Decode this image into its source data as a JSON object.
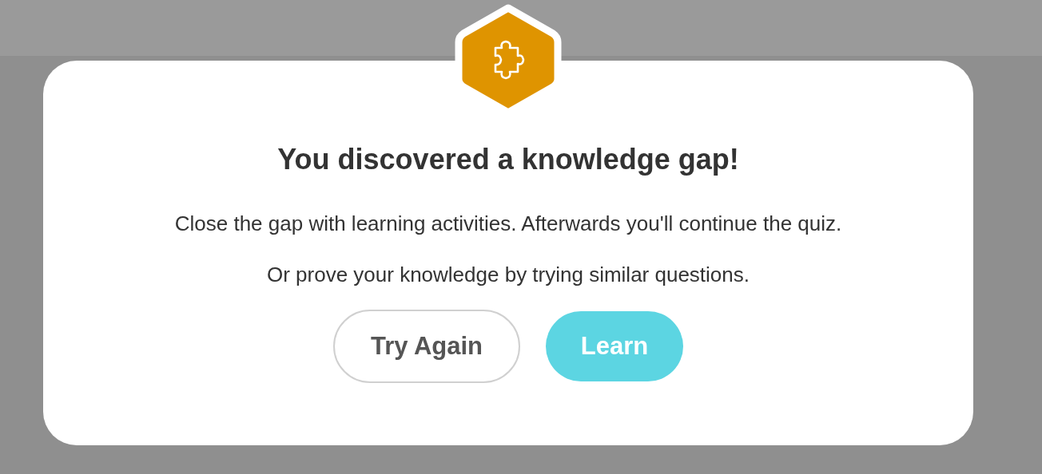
{
  "dialog": {
    "title": "You discovered a knowledge gap!",
    "paragraphs": [
      "Close the gap with learning activities. Afterwards you'll continue the quiz.",
      "Or prove your knowledge by trying similar questions."
    ],
    "buttons": [
      {
        "label": "Try Again",
        "kind": "secondary"
      },
      {
        "label": "Learn",
        "kind": "primary"
      }
    ]
  }
}
